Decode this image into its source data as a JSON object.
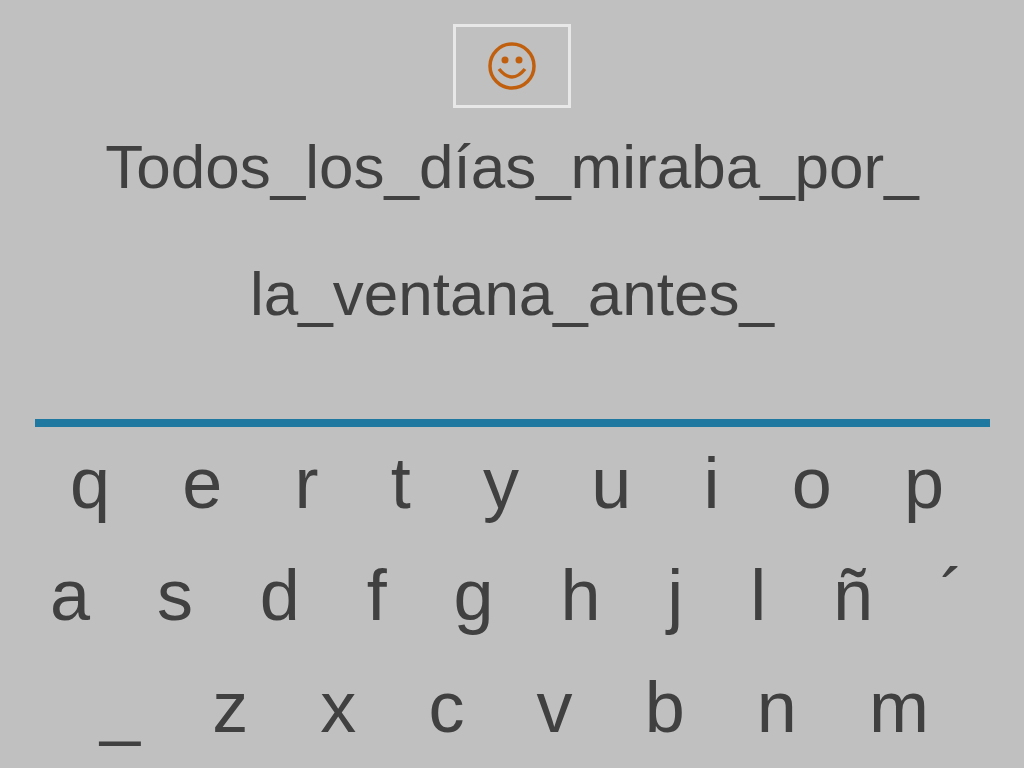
{
  "sentence_lines": [
    "Todos_los_días_miraba_por_",
    "la_ventana_antes_"
  ],
  "keyboard_rows": [
    [
      "q",
      "e",
      "r",
      "t",
      "y",
      "u",
      "i",
      "o",
      "p"
    ],
    [
      "a",
      "s",
      "d",
      "f",
      "g",
      "h",
      "j",
      "l",
      "ñ",
      "´"
    ],
    [
      "_",
      "z",
      "x",
      "c",
      "v",
      "b",
      "n",
      "m"
    ]
  ]
}
